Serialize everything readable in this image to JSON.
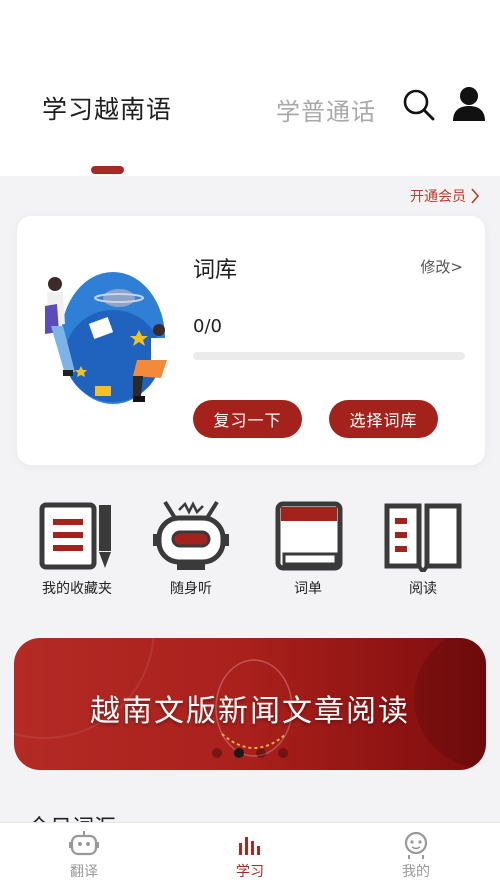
{
  "header": {
    "tabs": [
      {
        "label": "学习越南语",
        "active": true
      },
      {
        "label": "学普通话",
        "active": false
      }
    ],
    "icons": [
      "search-icon",
      "user-icon"
    ]
  },
  "vip_link": {
    "label": "开通会员",
    "icon": "chevron-right-icon"
  },
  "vocab_card": {
    "title": "词库",
    "edit_label": "修改>",
    "progress_text": "0/0",
    "progress_fraction": 0,
    "review_button": "复习一下",
    "choose_button": "选择词库"
  },
  "quick_actions": [
    {
      "label": "我的收藏夹",
      "icon": "notebook-pen-icon"
    },
    {
      "label": "随身听",
      "icon": "robot-radio-icon"
    },
    {
      "label": "词单",
      "icon": "book-icon"
    },
    {
      "label": "阅读",
      "icon": "open-book-icon"
    }
  ],
  "banner": {
    "text": "越南文版新闻文章阅读",
    "slide_count": 4,
    "active_slide": 2
  },
  "section_heading_partial": "今日词汇",
  "bottom_nav": [
    {
      "label": "翻译",
      "icon": "robot-icon",
      "active": false
    },
    {
      "label": "学习",
      "icon": "bars-icon",
      "active": true
    },
    {
      "label": "我的",
      "icon": "profile-icon",
      "active": false
    }
  ],
  "colors": {
    "accent": "#a52a24",
    "background": "#f3f3f5",
    "card": "#ffffff",
    "inactive_text": "#a9a9a9"
  }
}
